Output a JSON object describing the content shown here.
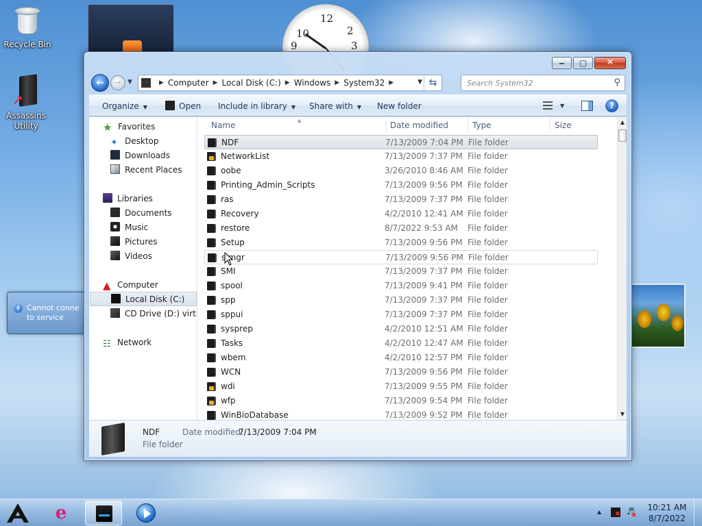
{
  "desktop": {
    "recycle_bin_label": "Recycle Bin",
    "assassins_label_line1": "Assassins",
    "assassins_label_line2": "Utility",
    "notice_text_line1": "Cannot conne",
    "notice_text_line2": "to service"
  },
  "clock_gadget": {
    "numbers": [
      "10",
      "12",
      "2",
      "9",
      "3"
    ]
  },
  "window": {
    "address": {
      "crumbs": [
        "Computer",
        "Local Disk (C:)",
        "Windows",
        "System32"
      ]
    },
    "search": {
      "placeholder": "Search System32"
    },
    "toolbar": {
      "organize": "Organize",
      "open": "Open",
      "include_in_library": "Include in library",
      "share_with": "Share with",
      "new_folder": "New folder"
    },
    "nav": {
      "favorites": "Favorites",
      "desktop": "Desktop",
      "downloads": "Downloads",
      "recent_places": "Recent Places",
      "libraries": "Libraries",
      "documents": "Documents",
      "music": "Music",
      "pictures": "Pictures",
      "videos": "Videos",
      "computer": "Computer",
      "local_disk": "Local Disk (C:)",
      "cd_drive": "CD Drive (D:) virtio-w",
      "network": "Network"
    },
    "columns": {
      "name": "Name",
      "date_modified": "Date modified",
      "type": "Type",
      "size": "Size"
    },
    "files": [
      {
        "name": "NDF",
        "date": "7/13/2009 7:04 PM",
        "type": "File folder"
      },
      {
        "name": "NetworkList",
        "date": "7/13/2009 7:37 PM",
        "type": "File folder"
      },
      {
        "name": "oobe",
        "date": "3/26/2010 8:46 AM",
        "type": "File folder"
      },
      {
        "name": "Printing_Admin_Scripts",
        "date": "7/13/2009 9:56 PM",
        "type": "File folder"
      },
      {
        "name": "ras",
        "date": "7/13/2009 7:37 PM",
        "type": "File folder"
      },
      {
        "name": "Recovery",
        "date": "4/2/2010 12:41 AM",
        "type": "File folder"
      },
      {
        "name": "restore",
        "date": "8/7/2022 9:53 AM",
        "type": "File folder"
      },
      {
        "name": "Setup",
        "date": "7/13/2009 9:56 PM",
        "type": "File folder"
      },
      {
        "name": "slmgr",
        "date": "7/13/2009 9:56 PM",
        "type": "File folder"
      },
      {
        "name": "SMI",
        "date": "7/13/2009 7:37 PM",
        "type": "File folder"
      },
      {
        "name": "spool",
        "date": "7/13/2009 9:41 PM",
        "type": "File folder"
      },
      {
        "name": "spp",
        "date": "7/13/2009 7:37 PM",
        "type": "File folder"
      },
      {
        "name": "sppui",
        "date": "7/13/2009 7:37 PM",
        "type": "File folder"
      },
      {
        "name": "sysprep",
        "date": "4/2/2010 12:51 AM",
        "type": "File folder"
      },
      {
        "name": "Tasks",
        "date": "4/2/2010 12:47 AM",
        "type": "File folder"
      },
      {
        "name": "wbem",
        "date": "4/2/2010 12:57 PM",
        "type": "File folder"
      },
      {
        "name": "WCN",
        "date": "7/13/2009 9:56 PM",
        "type": "File folder"
      },
      {
        "name": "wdi",
        "date": "7/13/2009 9:55 PM",
        "type": "File folder"
      },
      {
        "name": "wfp",
        "date": "7/13/2009 9:54 PM",
        "type": "File folder"
      },
      {
        "name": "WinBioDatabase",
        "date": "7/13/2009 9:52 PM",
        "type": "File folder"
      }
    ],
    "details": {
      "name": "NDF",
      "date_label": "Date modified:",
      "date_value": "7/13/2009 7:04 PM",
      "type": "File folder"
    }
  },
  "taskbar": {
    "time": "10:21 AM",
    "date": "8/7/2022"
  }
}
